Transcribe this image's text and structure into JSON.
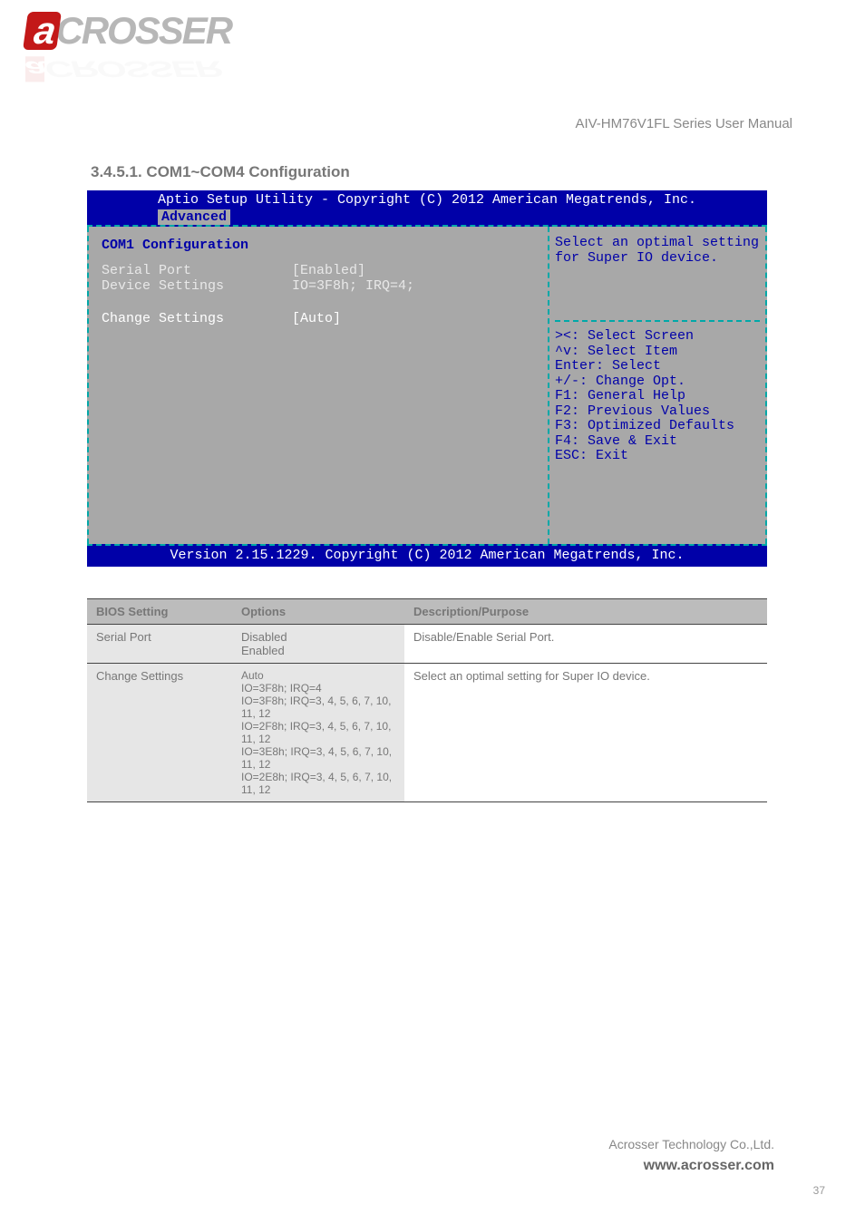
{
  "logo": {
    "a": "a",
    "rest": "CROSSER"
  },
  "doc_title": "AIV-HM76V1FL Series User Manual",
  "section": "3.4.5.1. COM1~COM4 Configuration",
  "bios": {
    "copyright_top": "Aptio Setup Utility - Copyright (C) 2012 American Megatrends, Inc.",
    "tab": "Advanced",
    "cfg_title": "COM1 Configuration",
    "rows": [
      {
        "label": "Serial Port",
        "value": "[Enabled]"
      },
      {
        "label": "Device Settings",
        "value": "IO=3F8h; IRQ=4;"
      }
    ],
    "change_label": "Change Settings",
    "change_value": "[Auto]",
    "help_top": "Select an optimal setting for Super IO device.",
    "keys": [
      "><: Select Screen",
      "^v: Select Item",
      "Enter: Select",
      "+/-: Change Opt.",
      "F1: General Help",
      "F2: Previous Values",
      "F3: Optimized Defaults",
      "F4: Save & Exit",
      "ESC: Exit"
    ],
    "footer": "Version 2.15.1229. Copyright (C) 2012 American Megatrends, Inc."
  },
  "table": {
    "headers": [
      "BIOS Setting",
      "Options",
      "Description/Purpose"
    ],
    "rows": [
      {
        "setting": "Serial Port",
        "options": "Disabled\nEnabled",
        "desc": "Disable/Enable Serial Port."
      },
      {
        "setting": "Change Settings",
        "options": "Auto\nIO=3F8h; IRQ=4\nIO=3F8h; IRQ=3, 4, 5, 6, 7, 10, 11, 12\nIO=2F8h; IRQ=3, 4, 5, 6, 7, 10, 11, 12\nIO=3E8h; IRQ=3, 4, 5, 6, 7, 10, 11, 12\nIO=2E8h; IRQ=3, 4, 5, 6, 7, 10, 11, 12",
        "desc": "Select an optimal setting for Super IO device."
      }
    ]
  },
  "footer": {
    "company": "Acrosser Technology Co.,Ltd.",
    "url": "www.acrosser.com",
    "page": "37"
  }
}
